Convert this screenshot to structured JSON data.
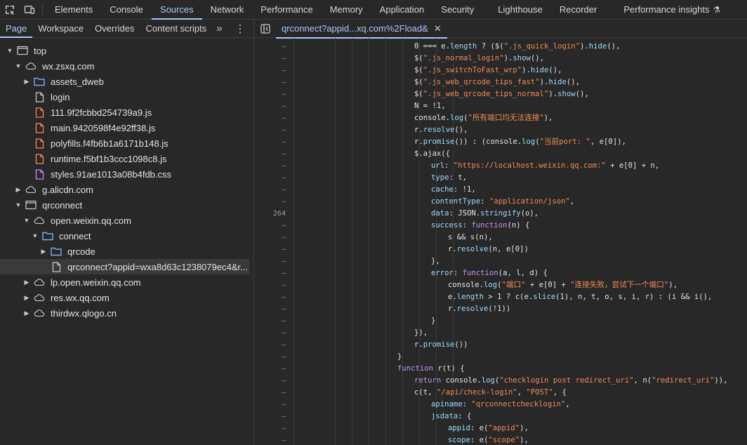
{
  "topbar": {
    "tabs": [
      "Elements",
      "Console",
      "Sources",
      "Network",
      "Performance",
      "Memory",
      "Application",
      "Security",
      "Lighthouse",
      "Recorder",
      "Performance insights"
    ],
    "active": "Sources"
  },
  "sources": {
    "subtabs": [
      "Page",
      "Workspace",
      "Overrides",
      "Content scripts"
    ],
    "active_subtab": "Page",
    "tree": [
      {
        "label": "top",
        "depth": 0,
        "icon": "frame-icon",
        "arrow": "down"
      },
      {
        "label": "wx.zsxq.com",
        "depth": 1,
        "icon": "cloud-icon",
        "arrow": "down"
      },
      {
        "label": "assets_dweb",
        "depth": 2,
        "icon": "folder-icon",
        "arrow": "right"
      },
      {
        "label": "login",
        "depth": 2,
        "icon": "document-icon",
        "arrow": ""
      },
      {
        "label": "111.9f2fcbbd254739a9.js",
        "depth": 2,
        "icon": "js-file-icon",
        "arrow": ""
      },
      {
        "label": "main.9420598f4e92ff38.js",
        "depth": 2,
        "icon": "js-file-icon",
        "arrow": ""
      },
      {
        "label": "polyfills.f4fb6b1a6171b148.js",
        "depth": 2,
        "icon": "js-file-icon",
        "arrow": ""
      },
      {
        "label": "runtime.f5bf1b3ccc1098c8.js",
        "depth": 2,
        "icon": "js-file-icon",
        "arrow": ""
      },
      {
        "label": "styles.91ae1013a08b4fdb.css",
        "depth": 2,
        "icon": "css-file-icon",
        "arrow": ""
      },
      {
        "label": "g.alicdn.com",
        "depth": 1,
        "icon": "cloud-icon",
        "arrow": "right"
      },
      {
        "label": "qrconnect",
        "depth": 1,
        "icon": "frame-icon",
        "arrow": "down"
      },
      {
        "label": "open.weixin.qq.com",
        "depth": 2,
        "icon": "cloud-icon",
        "arrow": "down"
      },
      {
        "label": "connect",
        "depth": 3,
        "icon": "folder-icon",
        "arrow": "down"
      },
      {
        "label": "qrcode",
        "depth": 4,
        "icon": "folder-icon",
        "arrow": "right"
      },
      {
        "label": "qrconnect?appid=wxa8d63c1238079ec4&r...",
        "depth": 4,
        "icon": "document-icon",
        "arrow": "",
        "selected": true
      },
      {
        "label": "lp.open.weixin.qq.com",
        "depth": 2,
        "icon": "cloud-icon",
        "arrow": "right"
      },
      {
        "label": "res.wx.qq.com",
        "depth": 2,
        "icon": "cloud-icon",
        "arrow": "right"
      },
      {
        "label": "thirdwx.qlogo.cn",
        "depth": 2,
        "icon": "cloud-icon",
        "arrow": "right"
      }
    ]
  },
  "editor": {
    "file_tab": "qrconnect?appid...xq.com%2Fload&",
    "line_number_label": "264",
    "code": [
      {
        "ind": 1,
        "t": [
          [
            "n",
            "0 === e."
          ],
          [
            "p",
            "length"
          ],
          [
            "n",
            " ? ($("
          ],
          [
            "s",
            "\".js_quick_login\""
          ],
          [
            "n",
            ")."
          ],
          [
            "p",
            "hide"
          ],
          [
            "n",
            "(),"
          ]
        ]
      },
      {
        "ind": 1,
        "t": [
          [
            "n",
            "$("
          ],
          [
            "s",
            "\".js_normal_login\""
          ],
          [
            "n",
            ")."
          ],
          [
            "p",
            "show"
          ],
          [
            "n",
            "(),"
          ]
        ]
      },
      {
        "ind": 1,
        "t": [
          [
            "n",
            "$("
          ],
          [
            "s",
            "\".js_switchToFast_wrp\""
          ],
          [
            "n",
            ")."
          ],
          [
            "p",
            "hide"
          ],
          [
            "n",
            "(),"
          ]
        ]
      },
      {
        "ind": 1,
        "t": [
          [
            "n",
            "$("
          ],
          [
            "s",
            "\".js_web_qrcode_tips_fast\""
          ],
          [
            "n",
            ")."
          ],
          [
            "p",
            "hide"
          ],
          [
            "n",
            "(),"
          ]
        ]
      },
      {
        "ind": 1,
        "t": [
          [
            "n",
            "$("
          ],
          [
            "s",
            "\".js_web_qrcode_tips_normal\""
          ],
          [
            "n",
            ")."
          ],
          [
            "p",
            "show"
          ],
          [
            "n",
            "(),"
          ]
        ]
      },
      {
        "ind": 1,
        "t": [
          [
            "n",
            "N = !1,"
          ]
        ]
      },
      {
        "ind": 1,
        "t": [
          [
            "n",
            "console."
          ],
          [
            "p",
            "log"
          ],
          [
            "n",
            "("
          ],
          [
            "s",
            "\"所有端口均无法连接\""
          ],
          [
            "n",
            "),"
          ]
        ]
      },
      {
        "ind": 1,
        "t": [
          [
            "n",
            "r."
          ],
          [
            "p",
            "resolve"
          ],
          [
            "n",
            "(),"
          ]
        ]
      },
      {
        "ind": 1,
        "t": [
          [
            "n",
            "r."
          ],
          [
            "p",
            "promise"
          ],
          [
            "n",
            "()) : (console."
          ],
          [
            "p",
            "log"
          ],
          [
            "n",
            "("
          ],
          [
            "s",
            "\"当前port: \""
          ],
          [
            "n",
            ", e[0]),"
          ]
        ]
      },
      {
        "ind": 1,
        "t": [
          [
            "n",
            "$.ajax({"
          ]
        ]
      },
      {
        "ind": 2,
        "t": [
          [
            "p",
            "url"
          ],
          [
            "n",
            ": "
          ],
          [
            "s",
            "\"https://localhost.weixin.qq.com:\""
          ],
          [
            "n",
            " + e[0] + n,"
          ]
        ]
      },
      {
        "ind": 2,
        "t": [
          [
            "p",
            "type"
          ],
          [
            "n",
            ": t,"
          ]
        ]
      },
      {
        "ind": 2,
        "t": [
          [
            "p",
            "cache"
          ],
          [
            "n",
            ": !1,"
          ]
        ]
      },
      {
        "ind": 2,
        "t": [
          [
            "p",
            "contentType"
          ],
          [
            "n",
            ": "
          ],
          [
            "s",
            "\"application/json\""
          ],
          [
            "n",
            ","
          ]
        ]
      },
      {
        "ind": 2,
        "t": [
          [
            "p",
            "data"
          ],
          [
            "n",
            ": JSON."
          ],
          [
            "p",
            "stringify"
          ],
          [
            "n",
            "(o),"
          ]
        ]
      },
      {
        "ind": 2,
        "t": [
          [
            "p",
            "success"
          ],
          [
            "n",
            ": "
          ],
          [
            "k",
            "function"
          ],
          [
            "n",
            "(n) {"
          ]
        ]
      },
      {
        "ind": 3,
        "t": [
          [
            "n",
            "s && s(n),"
          ]
        ]
      },
      {
        "ind": 3,
        "t": [
          [
            "n",
            "r."
          ],
          [
            "p",
            "resolve"
          ],
          [
            "n",
            "(n, e[0])"
          ]
        ]
      },
      {
        "ind": 2,
        "t": [
          [
            "n",
            "},"
          ]
        ]
      },
      {
        "ind": 2,
        "t": [
          [
            "p",
            "error"
          ],
          [
            "n",
            ": "
          ],
          [
            "k",
            "function"
          ],
          [
            "n",
            "(a, l, d) {"
          ]
        ]
      },
      {
        "ind": 3,
        "t": [
          [
            "n",
            "console."
          ],
          [
            "p",
            "log"
          ],
          [
            "n",
            "("
          ],
          [
            "s",
            "\"端口\""
          ],
          [
            "n",
            " + e[0] + "
          ],
          [
            "s",
            "\"连接失败，尝试下一个端口\""
          ],
          [
            "n",
            "),"
          ]
        ]
      },
      {
        "ind": 3,
        "t": [
          [
            "n",
            "e."
          ],
          [
            "p",
            "length"
          ],
          [
            "n",
            " > 1 ? c(e."
          ],
          [
            "p",
            "slice"
          ],
          [
            "n",
            "(1), n, t, o, s, i, r) : (i && i(),"
          ]
        ]
      },
      {
        "ind": 3,
        "t": [
          [
            "n",
            "r."
          ],
          [
            "p",
            "resolve"
          ],
          [
            "n",
            "(!1))"
          ]
        ]
      },
      {
        "ind": 2,
        "t": [
          [
            "n",
            "}"
          ]
        ]
      },
      {
        "ind": 1,
        "t": [
          [
            "n",
            "}),"
          ]
        ]
      },
      {
        "ind": 1,
        "t": [
          [
            "n",
            "r."
          ],
          [
            "p",
            "promise"
          ],
          [
            "n",
            "())"
          ]
        ]
      },
      {
        "ind": 0,
        "t": [
          [
            "n",
            "}"
          ]
        ]
      },
      {
        "ind": 0,
        "t": [
          [
            "k",
            "function"
          ],
          [
            "n",
            " r(t) {"
          ]
        ]
      },
      {
        "ind": 1,
        "t": [
          [
            "k",
            "return"
          ],
          [
            "n",
            " console."
          ],
          [
            "p",
            "log"
          ],
          [
            "n",
            "("
          ],
          [
            "s",
            "\"checklogin post redirect_uri\""
          ],
          [
            "n",
            ", n("
          ],
          [
            "s",
            "\"redirect_uri\""
          ],
          [
            "n",
            ")),"
          ]
        ]
      },
      {
        "ind": 1,
        "t": [
          [
            "n",
            "c(t, "
          ],
          [
            "s",
            "\"/api/check-login\""
          ],
          [
            "n",
            ", "
          ],
          [
            "s",
            "\"POST\""
          ],
          [
            "n",
            ", {"
          ]
        ]
      },
      {
        "ind": 2,
        "t": [
          [
            "p",
            "apiname"
          ],
          [
            "n",
            ": "
          ],
          [
            "s",
            "\"qrconnectchecklogin\""
          ],
          [
            "n",
            ","
          ]
        ]
      },
      {
        "ind": 2,
        "t": [
          [
            "p",
            "jsdata"
          ],
          [
            "n",
            ": {"
          ]
        ]
      },
      {
        "ind": 3,
        "t": [
          [
            "p",
            "appid"
          ],
          [
            "n",
            ": e("
          ],
          [
            "s",
            "\"appid\""
          ],
          [
            "n",
            "),"
          ]
        ]
      },
      {
        "ind": 3,
        "t": [
          [
            "p",
            "scope"
          ],
          [
            "n",
            ": e("
          ],
          [
            "s",
            "\"scope\""
          ],
          [
            "n",
            "),"
          ]
        ]
      }
    ]
  }
}
